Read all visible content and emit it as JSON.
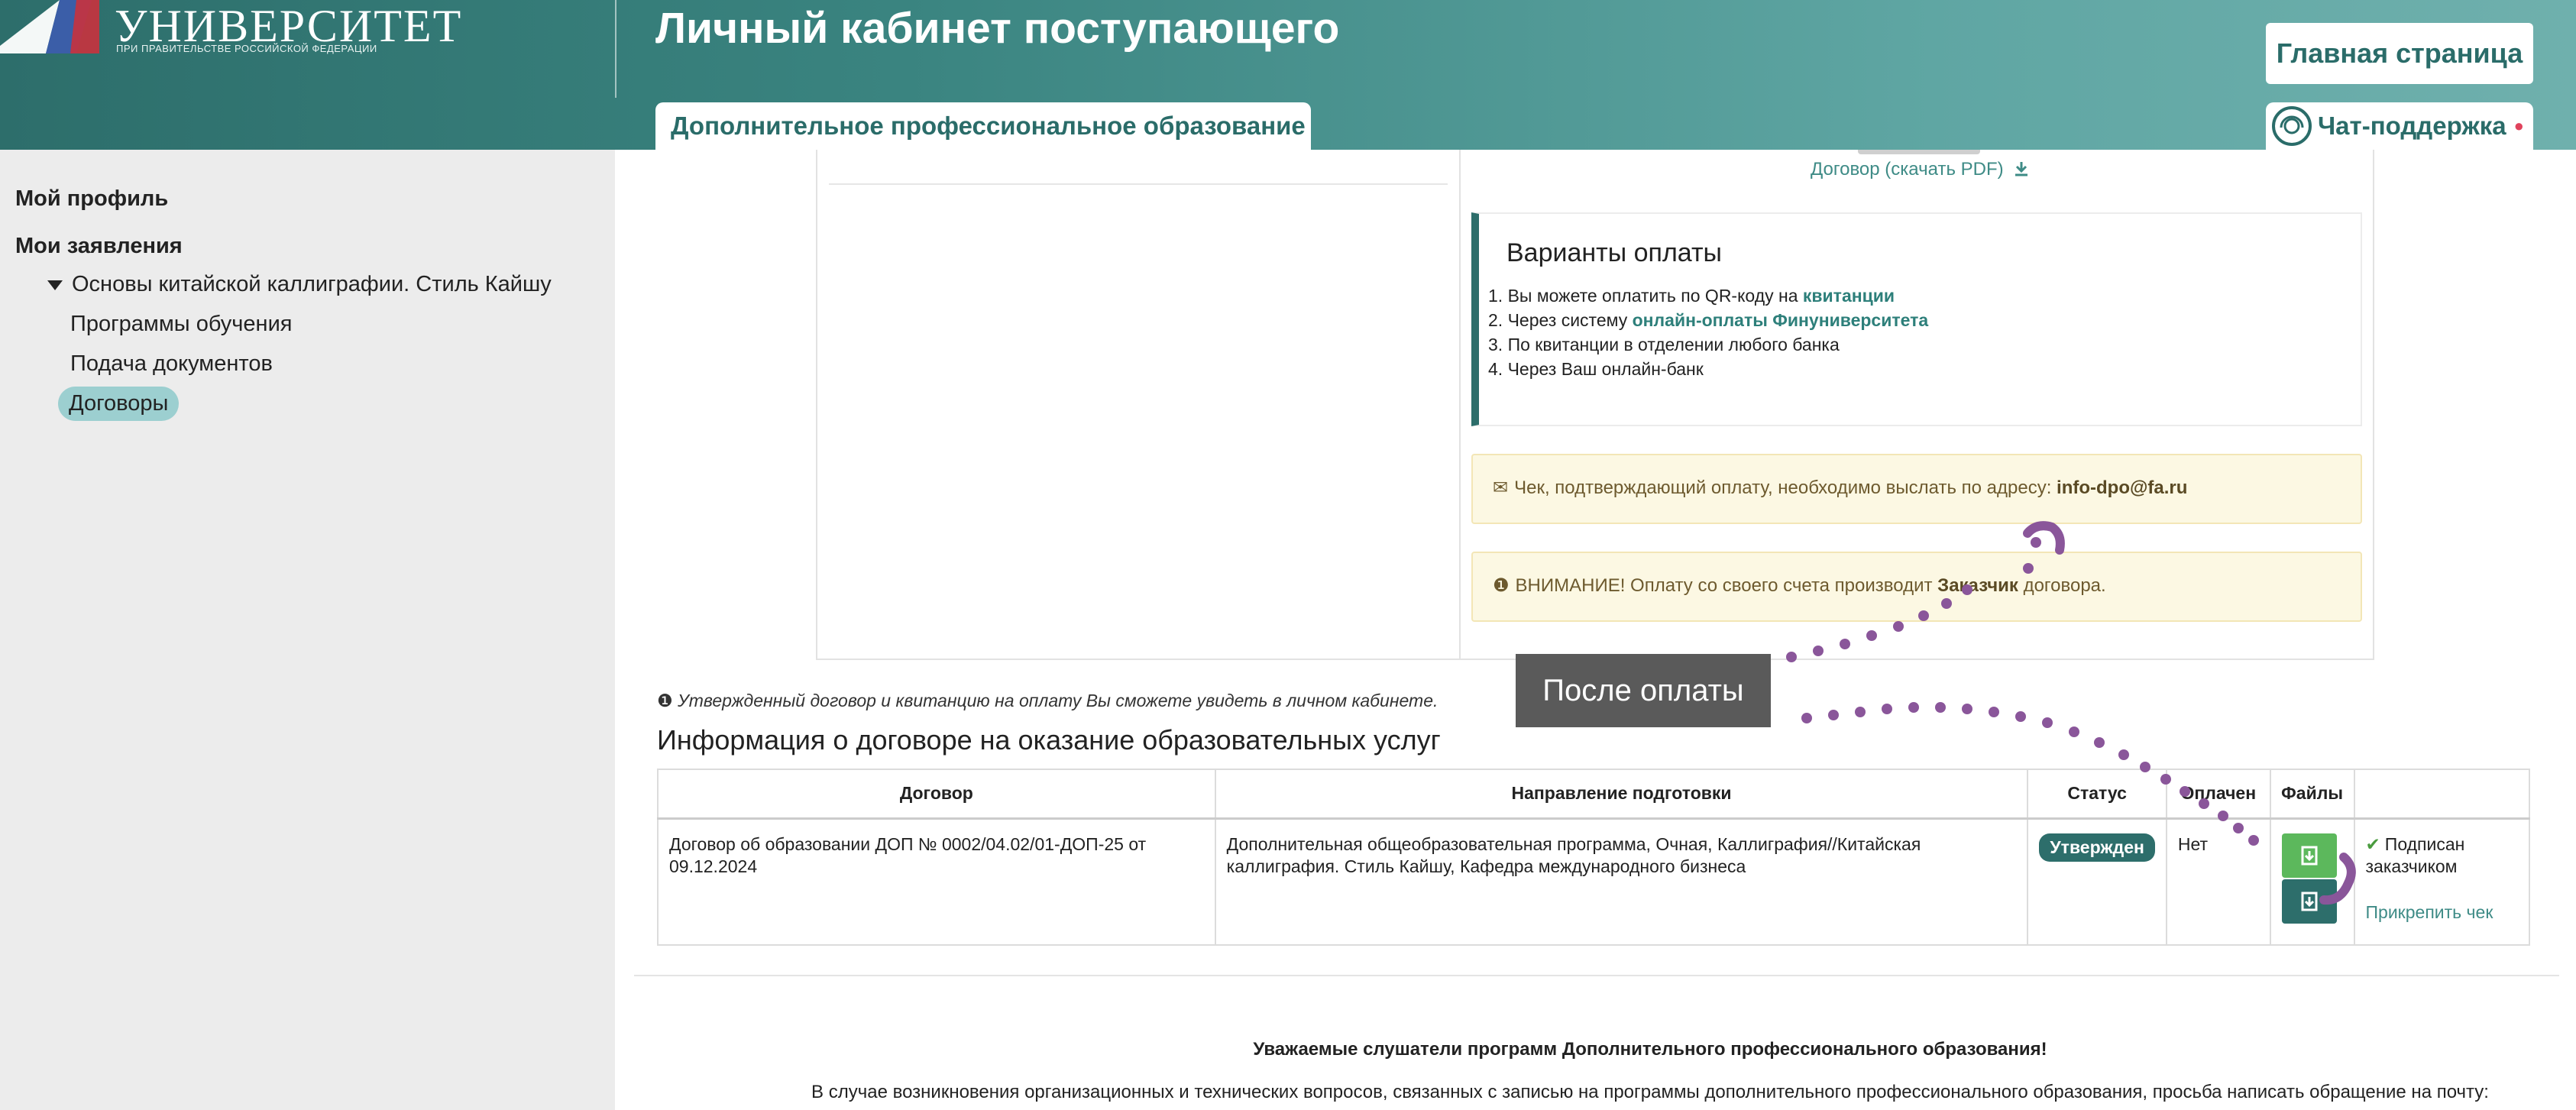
{
  "header": {
    "logo_title": "УНИВЕРСИТЕТ",
    "logo_subtitle": "ПРИ ПРАВИТЕЛЬСТВЕ РОССИЙСКОЙ ФЕДЕРАЦИИ",
    "page_title": "Личный кабинет поступающего",
    "home_button": "Главная страница",
    "active_tab": "Дополнительное профессиональное образование",
    "chat_support": "Чат-поддержка",
    "accent_color": "#2d6e6b"
  },
  "sidebar": {
    "profile": "Мой профиль",
    "applications": "Мои заявления",
    "program": "Основы китайской каллиграфии. Стиль Кайшу",
    "items": [
      "Программы обучения",
      "Подача документов",
      "Договоры"
    ],
    "active_item": "Договоры"
  },
  "contract_card": {
    "pdf_link": "Договор (скачать PDF)",
    "payment": {
      "title": "Варианты оплаты",
      "line1_prefix": "1. Вы можете оплатить по QR-коду на ",
      "line1_link": "квитанции",
      "line2_prefix": "2. Через систему ",
      "line2_link": "онлайн-оплаты Финуниверситета",
      "line3": "3. По квитанции в отделении любого банка",
      "line4": "4. Через Ваш онлайн-банк"
    },
    "alert_receipt_prefix": "Чек, подтверждающий оплату, необходимо выслать по адресу: ",
    "alert_receipt_email": "info-dpo@fa.ru",
    "alert_attention_prefix": "ВНИМАНИЕ! Оплату со своего счета производит ",
    "alert_attention_bold": "Заказчик",
    "alert_attention_suffix": " договора."
  },
  "annotation": "После оплаты",
  "info_note": "Утвержденный договор и квитанцию на оплату Вы сможете увидеть в личном кабинете.",
  "section_title": "Информация о договоре на оказание образовательных услуг",
  "table": {
    "headers": [
      "Договор",
      "Направление подготовки",
      "Статус",
      "Оплачен",
      "Файлы",
      ""
    ],
    "row": {
      "contract": "Договор об образовании ДОП № 0002/04.02/01-ДОП-25 от 09.12.2024",
      "direction": "Дополнительная общеобразовательная программа, Очная, Каллиграфия//Китайская каллиграфия. Стиль Кайшу, Кафедра международного бизнеса",
      "status": "Утвержден",
      "paid": "Нет",
      "signed": "Подписан заказчиком",
      "attach": "Прикрепить чек"
    }
  },
  "footer": {
    "title": "Уважаемые слушатели программ Дополнительного профессионального образования!",
    "text": "В случае возникновения организационных и технических вопросов, связанных с записью на программы дополнительного профессионального образования, просьба написать обращение на почту:"
  }
}
